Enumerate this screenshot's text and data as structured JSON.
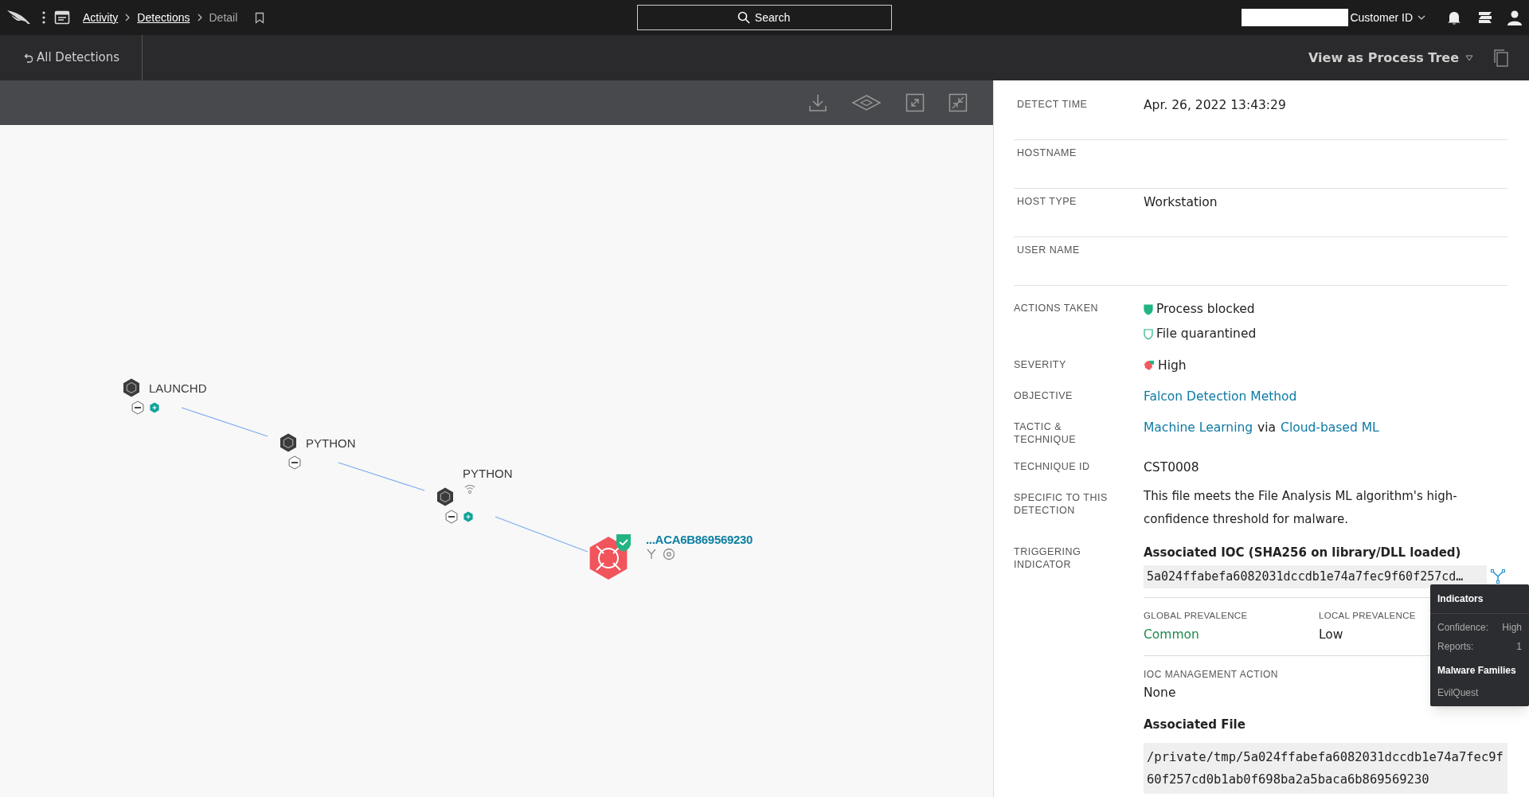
{
  "nav": {
    "breadcrumbs": [
      {
        "label": "Activity",
        "link": true
      },
      {
        "label": "Detections",
        "link": true
      },
      {
        "label": "Detail",
        "link": false
      }
    ],
    "search": {
      "placeholder": "Search"
    },
    "customer_id": "Customer ID"
  },
  "subheader": {
    "back": "All Detections",
    "view": "View as Process Tree"
  },
  "process_tree": {
    "nodes": [
      {
        "label": "LAUNCHD",
        "kind": "process",
        "collapsible": true,
        "hidden_children": true,
        "network_activity": false,
        "children": [
          {
            "label": "PYTHON",
            "kind": "process",
            "collapsible": true,
            "hidden_children": false,
            "network_activity": false,
            "children": [
              {
                "label": "PYTHON",
                "kind": "process",
                "collapsible": true,
                "hidden_children": true,
                "network_activity": true,
                "children": [
                  {
                    "label": "...ACA6B869569230",
                    "kind": "detection",
                    "collapsible": false,
                    "hidden_children": false,
                    "network_activity": false
                  }
                ]
              }
            ]
          }
        ]
      }
    ]
  },
  "details": [
    {
      "label": "DETECT TIME",
      "kind": "text",
      "value": "Apr. 26, 2022 13:43:29"
    },
    {
      "label": "HOSTNAME",
      "kind": "empty"
    },
    {
      "label": "HOST TYPE",
      "kind": "text",
      "value": "Workstation"
    },
    {
      "label": "USER NAME",
      "kind": "empty"
    },
    {
      "label": "ACTIONS TAKEN",
      "kind": "actions",
      "items": [
        {
          "text": "Process blocked",
          "filled": true
        },
        {
          "text": "File quarantined",
          "filled": false
        }
      ]
    },
    {
      "label": "SEVERITY",
      "kind": "severity",
      "value": "High",
      "color": "#f25a5f"
    },
    {
      "label": "OBJECTIVE",
      "kind": "link",
      "value": "Falcon Detection Method"
    },
    {
      "label": "TACTIC & TECHNIQUE",
      "kind": "tactic",
      "tactic": "Machine Learning",
      "joiner": "via",
      "technique": "Cloud-based ML"
    },
    {
      "label": "TECHNIQUE ID",
      "kind": "text",
      "value": "CST0008"
    },
    {
      "label": "SPECIFIC TO THIS DETECTION",
      "kind": "paragraph",
      "value": "This file meets the File Analysis ML algorithm's high-confidence threshold for malware."
    },
    {
      "label": "TRIGGERING INDICATOR",
      "kind": "ioc",
      "title": "Associated IOC (SHA256 on library/DLL loaded)",
      "hash": "5a024ffabefa6082031dccdb1e74a7fec9f60f257cd…",
      "prevalence": [
        {
          "label": "GLOBAL PREVALENCE",
          "value": "Common",
          "kind": "good"
        },
        {
          "label": "LOCAL PREVALENCE",
          "value": "Low",
          "kind": "plain"
        }
      ],
      "management": {
        "label": "IOC MANAGEMENT ACTION",
        "value": "None"
      },
      "file": {
        "title": "Associated File",
        "path": "/private/tmp/5a024ffabefa6082031dccdb1e74a7fec9f60f257cd0b1ab0f698ba2a5baca6b869569230"
      },
      "tooltip": {
        "title": "Indicators",
        "rows": [
          {
            "label": "Confidence:",
            "value": "High"
          },
          {
            "label": "Reports:",
            "value": "1"
          }
        ],
        "section": "Malware Families",
        "families": [
          "EvilQuest"
        ]
      }
    }
  ]
}
